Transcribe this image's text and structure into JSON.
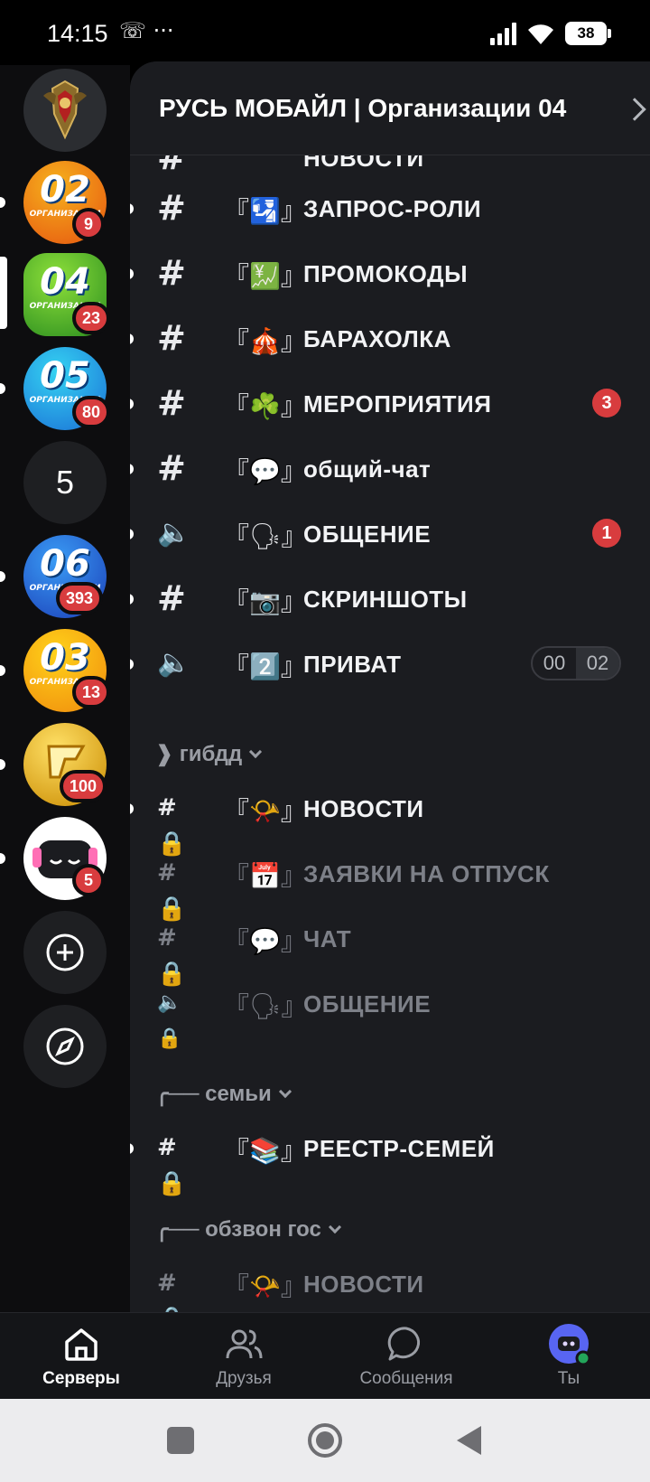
{
  "status_bar": {
    "time": "14:15",
    "left_icons": "☏ ···",
    "battery": "38"
  },
  "servers": [
    {
      "kind": "emblem",
      "name": "fsb-emblem"
    },
    {
      "kind": "org",
      "number": "02",
      "org_label": "ОРГАНИЗАЦИИ",
      "badge": "9",
      "colors": [
        "#f6b21d",
        "#e6530f"
      ]
    },
    {
      "kind": "org",
      "number": "04",
      "org_label": "ОРГАНИЗАЦИИ",
      "badge": "23",
      "colors": [
        "#7ed321",
        "#2a8d1f"
      ],
      "selected": true
    },
    {
      "kind": "org",
      "number": "05",
      "org_label": "ОРГАНИЗАЦИИ",
      "badge": "80",
      "colors": [
        "#35d3f2",
        "#1a6fd6"
      ]
    },
    {
      "kind": "folder",
      "label": "5"
    },
    {
      "kind": "org",
      "number": "06",
      "org_label": "ОРГАНИЗАЦИИ",
      "badge": "393",
      "colors": [
        "#2f8df0",
        "#1b3fb8"
      ]
    },
    {
      "kind": "org",
      "number": "03",
      "org_label": "ОРГАНИЗАЦИИ",
      "badge": "13",
      "colors": [
        "#ffd21a",
        "#f08a0c"
      ]
    },
    {
      "kind": "gold",
      "badge": "100"
    },
    {
      "kind": "bot",
      "badge": "5"
    }
  ],
  "panel": {
    "title": "РУСЬ МОБАЙЛ | Организации 04",
    "partial_channel": "НОВОСТИ",
    "channels": [
      {
        "icon": "#",
        "emoji": "『🛂』",
        "name": "ЗАПРОС-РОЛИ",
        "unread": true
      },
      {
        "icon": "#",
        "emoji": "『💹』",
        "name": "ПРОМОКОДЫ",
        "unread": true
      },
      {
        "icon": "#",
        "emoji": "『🎪』",
        "name": "БАРАХОЛКА",
        "unread": true
      },
      {
        "icon": "#",
        "emoji": "『☘️』",
        "name": "МЕРОПРИЯТИЯ",
        "unread": true,
        "badge": "3"
      },
      {
        "icon": "#",
        "emoji": "『💬』",
        "name": "общий-чат",
        "unread": true
      },
      {
        "icon": "🔈",
        "emoji": "『🗣』",
        "name": "ОБЩЕНИЕ",
        "unread": true,
        "badge": "1"
      },
      {
        "icon": "#",
        "emoji": "『📷』",
        "name": "СКРИНШОТЫ",
        "unread": true
      },
      {
        "icon": "🔈",
        "emoji": "『2️⃣』",
        "name": "ПРИВАТ",
        "unread": true,
        "voice_count": [
          "00",
          "02"
        ]
      }
    ],
    "category_gibdd": "❱ гибдд",
    "gibdd_channels": [
      {
        "icon": "#🔒",
        "emoji": "『📯』",
        "name": "НОВОСТИ",
        "unread": true
      },
      {
        "icon": "#🔒",
        "emoji": "『📅』",
        "name": "ЗАЯВКИ НА ОТПУСК",
        "muted": true
      },
      {
        "icon": "#🔒",
        "emoji": "『💬』",
        "name": "ЧАТ",
        "muted": true
      },
      {
        "icon": "🔈🔒",
        "emoji": "『🗣』",
        "name": "ОБЩЕНИЕ",
        "muted": true
      }
    ],
    "category_families": "╭── семьи",
    "families_channels": [
      {
        "icon": "#🔒",
        "emoji": "『📚』",
        "name": "РЕЕСТР-СЕМЕЙ",
        "unread": true
      }
    ],
    "category_obzvon": "╭── обзвон гос",
    "obzvon_channels": [
      {
        "icon": "#🔒",
        "emoji": "『📯』",
        "name": "НОВОСТИ",
        "muted": true
      }
    ]
  },
  "bottom_nav": {
    "servers": "Серверы",
    "friends": "Друзья",
    "messages": "Сообщения",
    "you": "Ты"
  }
}
